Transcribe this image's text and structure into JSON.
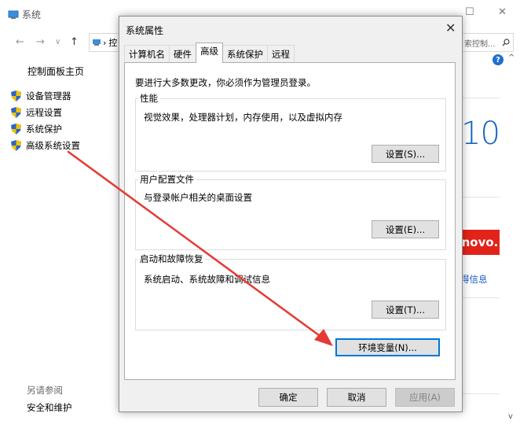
{
  "background_window": {
    "title": "系统",
    "address_fragment": "控",
    "search_placeholder": "索控制...",
    "controls": {
      "minimize": "—",
      "maximize": "☐",
      "close": "✕"
    },
    "nav": {
      "back": "←",
      "forward": "→",
      "recent": "∨",
      "up": "↑"
    },
    "sidebar": {
      "home": "控制面板主页",
      "items": [
        {
          "label": "设备管理器",
          "icon": "shield-icon"
        },
        {
          "label": "远程设置",
          "icon": "shield-icon"
        },
        {
          "label": "系统保护",
          "icon": "shield-icon"
        },
        {
          "label": "高级系统设置",
          "icon": "shield-icon"
        }
      ],
      "see_also": "另请参阅",
      "see_also_items": [
        "安全和维护"
      ]
    },
    "right": {
      "win_version": "10",
      "brand": "novo.",
      "more_info_link": "得信息"
    },
    "help": "?"
  },
  "dialog": {
    "title": "系统属性",
    "close": "✕",
    "tabs": [
      {
        "label": "计算机名",
        "active": false
      },
      {
        "label": "硬件",
        "active": false
      },
      {
        "label": "高级",
        "active": true
      },
      {
        "label": "系统保护",
        "active": false
      },
      {
        "label": "远程",
        "active": false
      }
    ],
    "notice": "要进行大多数更改，你必须作为管理员登录。",
    "groups": [
      {
        "label": "性能",
        "desc": "视觉效果，处理器计划，内存使用，以及虚拟内存",
        "button": "设置(S)..."
      },
      {
        "label": "用户配置文件",
        "desc": "与登录帐户相关的桌面设置",
        "button": "设置(E)..."
      },
      {
        "label": "启动和故障恢复",
        "desc": "系统启动、系统故障和调试信息",
        "button": "设置(T)..."
      }
    ],
    "env_button": "环境变量(N)...",
    "footer": {
      "ok": "确定",
      "cancel": "取消",
      "apply": "应用(A)"
    }
  },
  "annotation": {
    "arrow_color": "#e53935"
  }
}
